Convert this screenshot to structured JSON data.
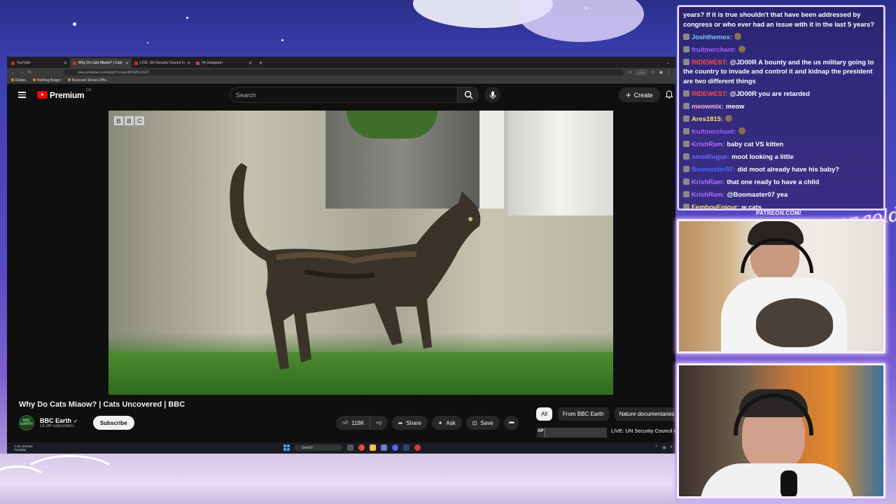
{
  "browser": {
    "tabs": [
      {
        "label": "YouTube",
        "active": false,
        "favicon": "youtube-favicon"
      },
      {
        "label": "Why Do Cats Miaow? | Cats Uncovered | BBC",
        "active": true,
        "favicon": "youtube-favicon"
      },
      {
        "label": "LIVE: UN Security Council meeting",
        "active": false,
        "favicon": "youtube-favicon"
      },
      {
        "label": "(4) Instagram",
        "active": false,
        "favicon": "instagram-favicon"
      }
    ],
    "url": "www.youtube.com/watch?v=qeUM1WDoOGY",
    "zoom": "110%",
    "bookmarks": [
      "Dailies",
      "Nothing Burger",
      "Bodycam Shows Offic..."
    ]
  },
  "youtube": {
    "logo_text": "Premium",
    "region": "CA",
    "search_placeholder": "Search",
    "create_label": "Create",
    "video": {
      "watermark": [
        "B",
        "B",
        "C"
      ],
      "title": "Why Do Cats Miaow? | Cats Uncovered | BBC",
      "channel_name": "BBC Earth",
      "channel_avatar_text": "BBC EARTH",
      "subscribers": "14.2M subscribers",
      "subscribe_label": "Subscribe",
      "likes": "118K",
      "share_label": "Share",
      "ask_label": "Ask",
      "save_label": "Save"
    },
    "chips": [
      {
        "label": "All",
        "selected": true
      },
      {
        "label": "From BBC Earth",
        "selected": false
      },
      {
        "label": "Nature documentaries",
        "selected": false
      }
    ],
    "recommendation": {
      "title": "LIVE: UN Security Council emergency meeting on US..."
    }
  },
  "taskbar": {
    "weather": "1 cm of snow",
    "day": "Tuesday",
    "search_placeholder": "Search"
  },
  "chat": {
    "messages": [
      {
        "user": "",
        "text": "years? If it is true shouldn't that have been addressed by congress or who ever had an issue with it in the last 5 years?",
        "color": "#ffffff"
      },
      {
        "user": "Joshthemex:",
        "text": "",
        "color": "#7fc8ff",
        "emote": true
      },
      {
        "user": "fruitmerchant:",
        "text": "",
        "color": "#a060ff",
        "emote": true
      },
      {
        "user": "RIDEWEST:",
        "text": "@JD00R A bounty and the us military going to the country to invade and control it and kidnap the president are two different things",
        "color": "#ff4a4a"
      },
      {
        "user": "RIDEWEST:",
        "text": "@JD00R you are retarded",
        "color": "#ff4a4a"
      },
      {
        "user": "meowmix:",
        "text": "meow",
        "color": "#ffb3e6"
      },
      {
        "user": "Ares1815:",
        "text": "",
        "color": "#ffe66b",
        "emote": true
      },
      {
        "user": "fruitmerchant:",
        "text": "",
        "color": "#a060ff",
        "emote": true
      },
      {
        "user": "KrishRam:",
        "text": "baby cat VS kitten",
        "color": "#b36bff"
      },
      {
        "user": "smolRogue:",
        "text": "moot looking a little",
        "color": "#6a6aff"
      },
      {
        "user": "Boomaster07:",
        "text": "did moot already have his baby?",
        "color": "#4a6aff"
      },
      {
        "user": "KrishRam:",
        "text": "that one ready to have a child",
        "color": "#b36bff"
      },
      {
        "user": "KrishRam:",
        "text": "@Boomaster07 yea",
        "color": "#b36bff"
      },
      {
        "user": "FemboyEnjoyr:",
        "text": "w cats",
        "color": "#ffe66b"
      }
    ]
  },
  "overlay": {
    "patreon": "PATREON.COM/",
    "signature": "Asmongold"
  }
}
